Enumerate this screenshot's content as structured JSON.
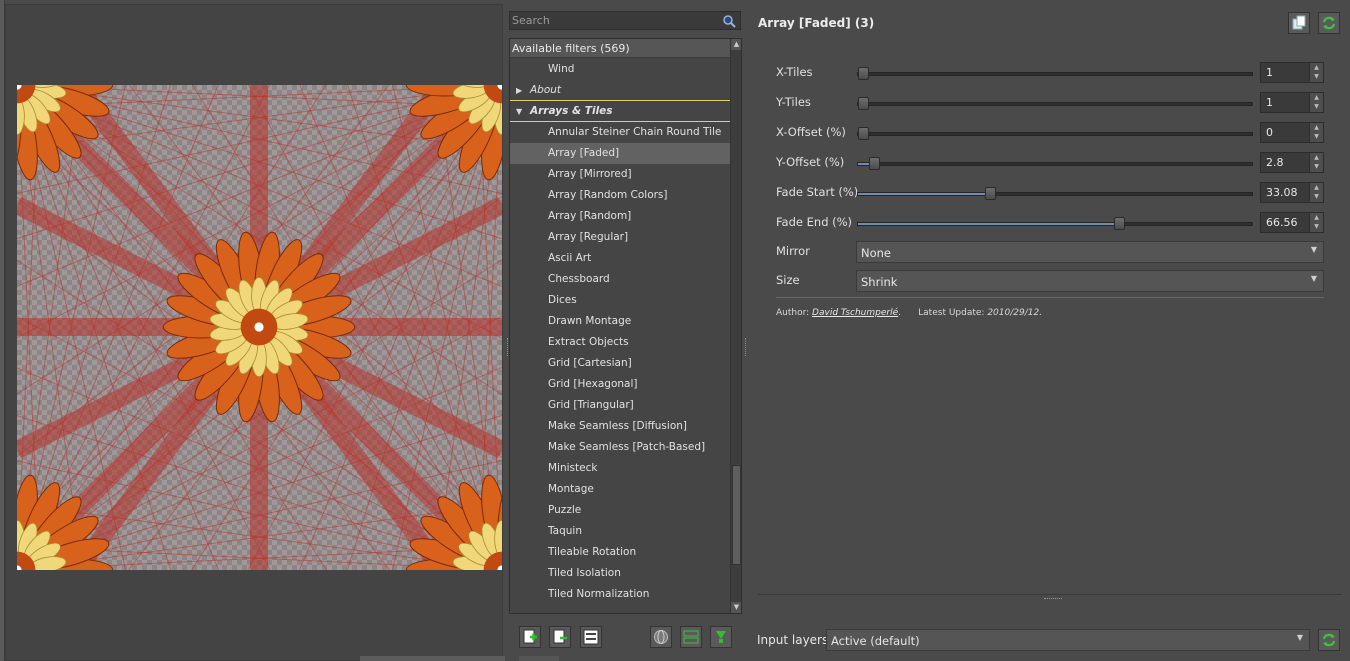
{
  "search": {
    "placeholder": "Search"
  },
  "filters": {
    "header": "Available filters (569)",
    "items": [
      {
        "label": "Wind",
        "kind": "item"
      },
      {
        "label": "About",
        "kind": "folder",
        "expanded": false
      },
      {
        "label": "Arrays & Tiles",
        "kind": "folder",
        "expanded": true
      },
      {
        "label": "Annular Steiner Chain Round Tile",
        "kind": "item"
      },
      {
        "label": "Array [Faded]",
        "kind": "item",
        "selected": true
      },
      {
        "label": "Array [Mirrored]",
        "kind": "item"
      },
      {
        "label": "Array [Random Colors]",
        "kind": "item"
      },
      {
        "label": "Array [Random]",
        "kind": "item"
      },
      {
        "label": "Array [Regular]",
        "kind": "item"
      },
      {
        "label": "Ascii Art",
        "kind": "item"
      },
      {
        "label": "Chessboard",
        "kind": "item"
      },
      {
        "label": "Dices",
        "kind": "item"
      },
      {
        "label": "Drawn Montage",
        "kind": "item"
      },
      {
        "label": "Extract Objects",
        "kind": "item"
      },
      {
        "label": "Grid [Cartesian]",
        "kind": "item"
      },
      {
        "label": "Grid [Hexagonal]",
        "kind": "item"
      },
      {
        "label": "Grid [Triangular]",
        "kind": "item"
      },
      {
        "label": "Make Seamless [Diffusion]",
        "kind": "item"
      },
      {
        "label": "Make Seamless [Patch-Based]",
        "kind": "item"
      },
      {
        "label": "Ministeck",
        "kind": "item"
      },
      {
        "label": "Montage",
        "kind": "item"
      },
      {
        "label": "Puzzle",
        "kind": "item"
      },
      {
        "label": "Taquin",
        "kind": "item"
      },
      {
        "label": "Tileable Rotation",
        "kind": "item"
      },
      {
        "label": "Tiled Isolation",
        "kind": "item"
      },
      {
        "label": "Tiled Normalization",
        "kind": "item"
      }
    ]
  },
  "params": {
    "title": "Array [Faded] (3)",
    "sliders": [
      {
        "label": "X-Tiles",
        "value": "1",
        "fraction": 0.0
      },
      {
        "label": "Y-Tiles",
        "value": "1",
        "fraction": 0.0
      },
      {
        "label": "X-Offset (%)",
        "value": "0",
        "fraction": 0.0
      },
      {
        "label": "Y-Offset (%)",
        "value": "2.8",
        "fraction": 0.028
      },
      {
        "label": "Fade Start (%)",
        "value": "33.08",
        "fraction": 0.3308
      },
      {
        "label": "Fade End (%)",
        "value": "66.56",
        "fraction": 0.6656
      }
    ],
    "mirror": {
      "label": "Mirror",
      "value": "None"
    },
    "size": {
      "label": "Size",
      "value": "Shrink"
    },
    "author_prefix": "Author: ",
    "author_name": "David Tschumperlé",
    "update_prefix": "Latest Update: ",
    "update_date": "2010/29/12."
  },
  "input_layers": {
    "label": "Input layers",
    "value": "Active (default)"
  },
  "colors": {
    "accent": "#6c8fb0",
    "folder_underline": "#d8d36a",
    "refresh_green": "#3cc43c"
  },
  "icons": [
    "search-icon",
    "add-favorite-icon",
    "remove-favorite-icon",
    "rename-favorite-icon",
    "globe-icon",
    "expand-collapse-icon",
    "update-filters-icon",
    "copy-to-clipboard-icon",
    "refresh-icon"
  ]
}
